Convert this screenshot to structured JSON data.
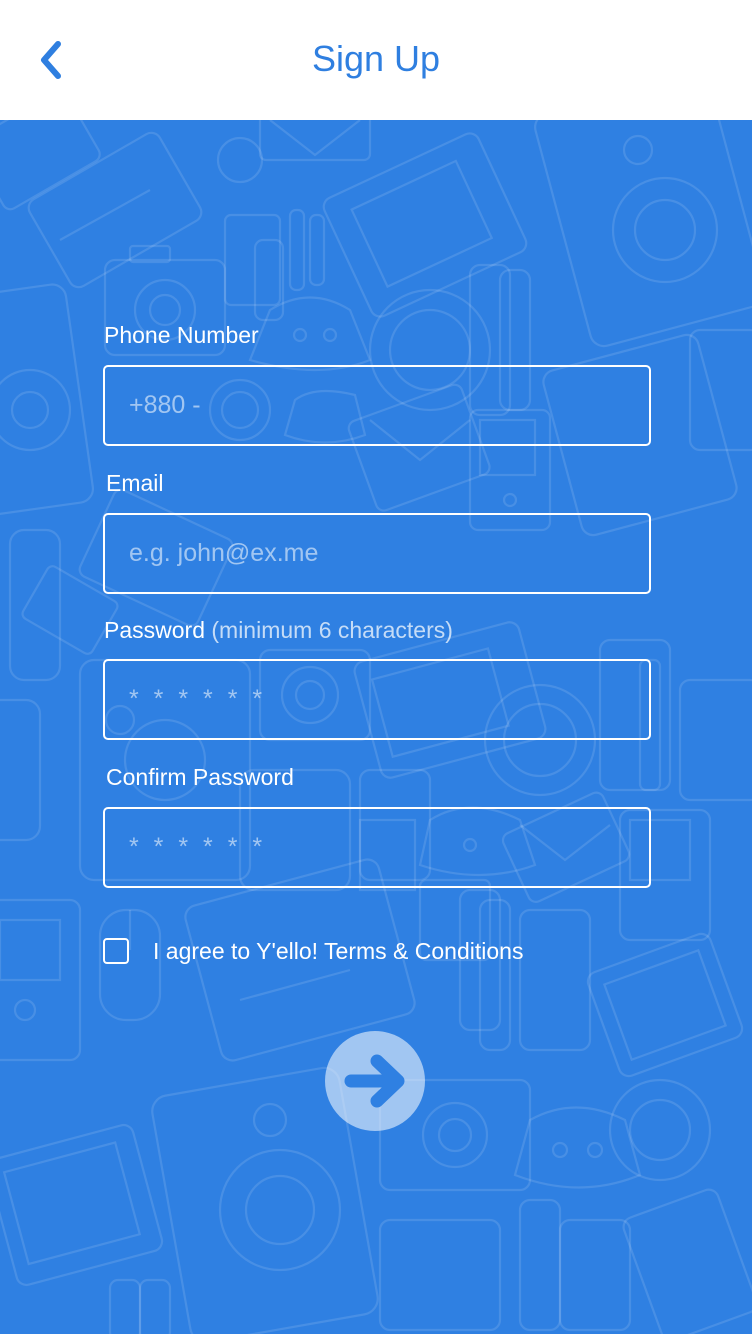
{
  "header": {
    "title": "Sign Up",
    "back_icon": "chevron-left-icon"
  },
  "form": {
    "phone": {
      "label": "Phone Number",
      "placeholder": "+880 -"
    },
    "email": {
      "label": "Email",
      "placeholder": "e.g. john@ex.me"
    },
    "password": {
      "label": "Password",
      "hint": "(minimum 6 characters)",
      "placeholder": "* * * * * *"
    },
    "confirm_password": {
      "label": "Confirm Password",
      "placeholder": "* * * * * *"
    },
    "terms": {
      "label": "I agree to Y'ello! Terms & Conditions",
      "checked": false
    },
    "submit_icon": "arrow-right-icon"
  },
  "colors": {
    "accent": "#2f7fe0",
    "background": "#2f80e2",
    "field_border": "#ffffff"
  }
}
